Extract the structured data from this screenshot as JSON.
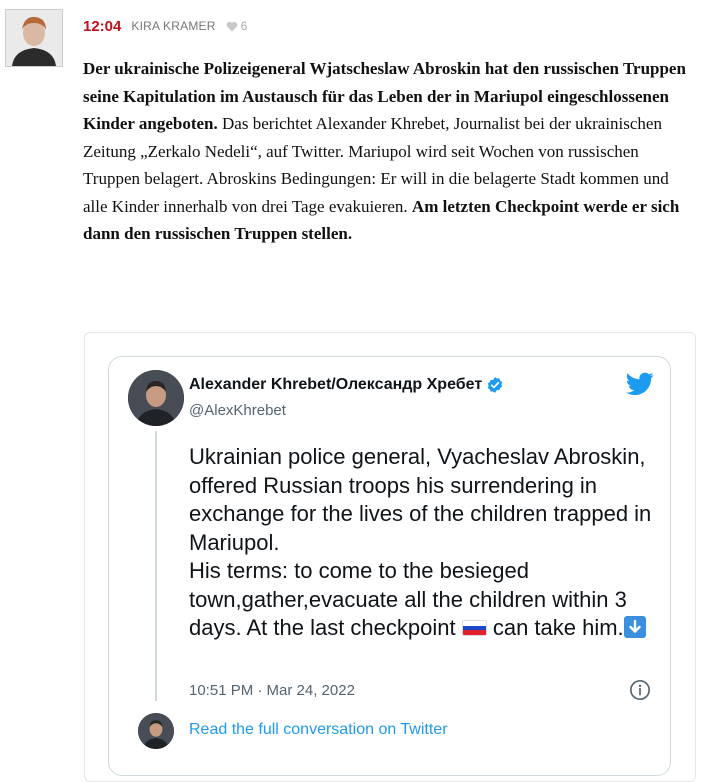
{
  "comment": {
    "time": "12:04",
    "author": "KIRA KRAMER",
    "likes": "6",
    "paragraph": [
      {
        "text": "Der ukrainische Polizeigeneral Wjatscheslaw Abroskin hat den russischen Truppen seine Kapitulation im Austausch für das Leben der in Mariupol eingeschlossenen Kinder angeboten.",
        "bold": true
      },
      {
        "text": " Das berichtet Alexander Khrebet, Journalist bei der ukrainischen Zeitung „Zerkalo Nedeli“, auf Twitter. Mariupol wird seit Wochen von russischen Truppen belagert. Abroskins Bedingungen: Er will in die belagerte Stadt kommen und alle Kinder innerhalb von drei Tage evakuieren. ",
        "bold": false
      },
      {
        "text": "Am letzten Checkpoint werde er sich dann den russischen Truppen stellen.",
        "bold": true
      }
    ]
  },
  "tweet": {
    "display_name": "Alexander Khrebet/Олександр Хребет",
    "handle": "@AlexKhrebet",
    "text_line1": "Ukrainian police general, Vyacheslav Abroskin, offered Russian troops his surrendering in exchange for the lives of the children trapped in Mariupol.",
    "text_line2_before": "His terms: to come to the besieged town,gather,evacuate all the children within 3 days. At the last checkpoint ",
    "text_line2_after": " can take him.",
    "timestamp": "10:51 PM · Mar 24, 2022",
    "read_more": "Read the full conversation on Twitter",
    "icons": {
      "verified": "verified-badge-icon",
      "logo": "twitter-bird-icon",
      "flag": "russia-flag-emoji",
      "arrow": "down-arrow-emoji",
      "info": "info-icon"
    },
    "colors": {
      "link": "#1d9bf0",
      "time_red": "#c0101b"
    }
  }
}
